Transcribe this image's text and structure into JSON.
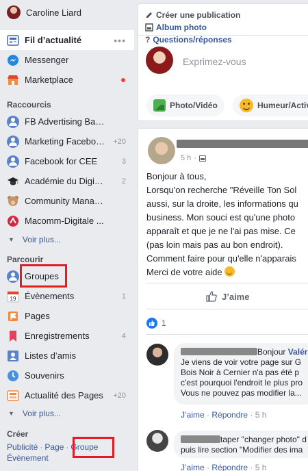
{
  "profile": {
    "name": "Caroline Liard"
  },
  "nav": {
    "news_feed": "Fil d’actualité",
    "messenger": "Messenger",
    "marketplace": "Marketplace"
  },
  "shortcuts": {
    "title": "Raccourcis",
    "items": [
      {
        "label": "FB Advertising Bas...",
        "count": ""
      },
      {
        "label": "Marketing Faceboo...",
        "count": "+20"
      },
      {
        "label": "Facebook for CEE",
        "count": "3"
      },
      {
        "label": "Académie du Digita...",
        "count": "2"
      },
      {
        "label": "Community Manag...",
        "count": ""
      },
      {
        "label": "Macomm-Digitale ...",
        "count": ""
      }
    ],
    "more": "Voir plus..."
  },
  "explore": {
    "title": "Parcourir",
    "items": [
      {
        "label": "Groupes",
        "count": ""
      },
      {
        "label": "Évènements",
        "count": "1"
      },
      {
        "label": "Pages",
        "count": ""
      },
      {
        "label": "Enregistrements",
        "count": "4"
      },
      {
        "label": "Listes d’amis",
        "count": ""
      },
      {
        "label": "Souvenirs",
        "count": ""
      },
      {
        "label": "Actualité des Pages",
        "count": "+20"
      }
    ],
    "calendar_day": "19",
    "more": "Voir plus..."
  },
  "create": {
    "title": "Créer",
    "links": [
      "Publicité",
      "Page",
      "Groupe",
      "Évènement"
    ]
  },
  "composer": {
    "tab_create": "Créer une publication",
    "tab_album": "Album photo",
    "tab_qa": "Questions/réponses",
    "placeholder": "Exprimez-vous",
    "btn_photo": "Photo/Vidéo",
    "btn_mood": "Humeur/Activité"
  },
  "post": {
    "time": "5 h",
    "text": [
      "Bonjour à tous,",
      "Lorsqu'on recherche \"Réveille Ton Sol",
      "aussi, sur la droite, les informations qu",
      "business. Mon souci est qu'une photo",
      "apparaît et que je ne l'ai pas mise. Ce",
      "(pas loin mais pas au bon endroit).",
      "Comment faire pour qu'elle n'apparais",
      "Merci de votre aide"
    ],
    "like_label": "J’aime",
    "reaction_count": "1"
  },
  "comments": [
    {
      "author": "Valér",
      "lines": [
        "Bonjour",
        "Je viens de voir votre page sur G",
        "Bois Noir à Cernier n'a pas été p",
        "c'est pourquoi l'endroit le plus pro",
        "Vous ne pouvez pas modifier la..."
      ],
      "like": "J’aime",
      "reply": "Répondre",
      "time": "5 h"
    },
    {
      "lines": [
        "taper \"changer photo\" d",
        "puis lire section \"Modifier des ima"
      ],
      "like": "J’aime",
      "reply": "Répondre",
      "time": "5 h"
    }
  ],
  "colors": {
    "accent": "#365899",
    "highlight": "#e41b23",
    "background": "#e9ebee"
  }
}
